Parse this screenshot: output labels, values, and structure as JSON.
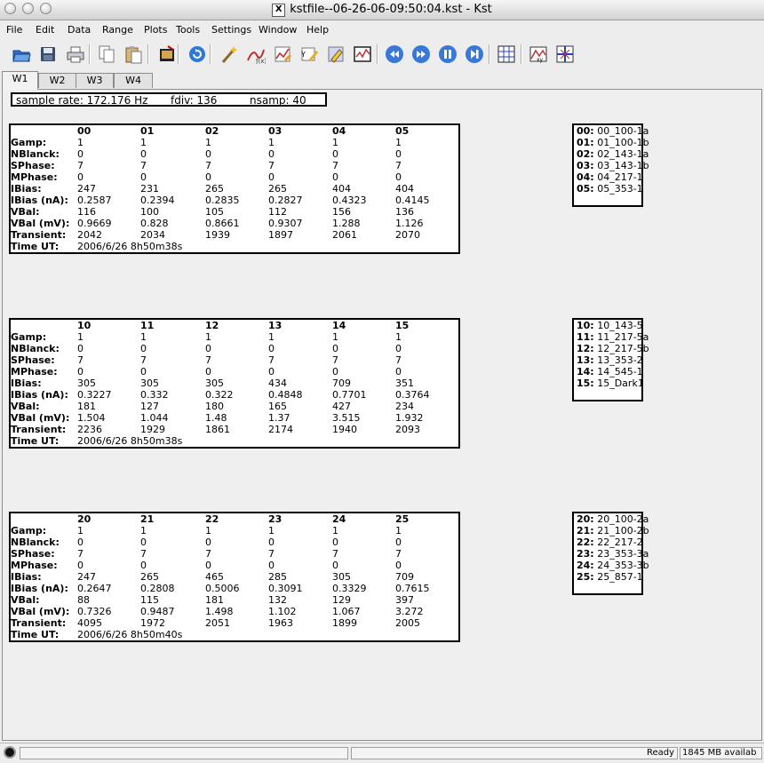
{
  "window": {
    "title": "kstfile--06-26-06-09:50:04.kst - Kst",
    "x_badge": "X"
  },
  "menu": [
    "File",
    "Edit",
    "Data",
    "Range",
    "Plots",
    "Tools",
    "Settings",
    "Window",
    "Help"
  ],
  "toolbar_icons": [
    "open-icon",
    "save-icon",
    "print-icon",
    "copy-icon",
    "paste-icon",
    "export-icon",
    "reload-icon",
    "data-wizard-icon",
    "plot-wizard-icon",
    "edit-plot-icon",
    "label-icon",
    "draw-icon",
    "graph-icon",
    "back-icon",
    "forward-icon",
    "pause-icon",
    "end-icon",
    "grid-icon",
    "plot-dialog-icon",
    "zoom-icon"
  ],
  "tabs": [
    "W1",
    "W2",
    "W3",
    "W4"
  ],
  "info": {
    "sample_rate": "sample rate: 172.176 Hz",
    "fdiv": "fdiv: 136",
    "nsamp": "nsamp: 40"
  },
  "row_labels": [
    "Gamp:",
    "NBlanck:",
    "SPhase:",
    "MPhase:",
    "IBias:",
    "IBias (nA):",
    "VBal:",
    "VBal (mV):",
    "Transient:",
    "Time UT:"
  ],
  "panels": [
    {
      "channels": [
        "00",
        "01",
        "02",
        "03",
        "04",
        "05"
      ],
      "rows": [
        [
          "1",
          "1",
          "1",
          "1",
          "1",
          "1"
        ],
        [
          "0",
          "0",
          "0",
          "0",
          "0",
          "0"
        ],
        [
          "7",
          "7",
          "7",
          "7",
          "7",
          "7"
        ],
        [
          "0",
          "0",
          "0",
          "0",
          "0",
          "0"
        ],
        [
          "247",
          "231",
          "265",
          "265",
          "404",
          "404"
        ],
        [
          "0.2587",
          "0.2394",
          "0.2835",
          "0.2827",
          "0.4323",
          "0.4145"
        ],
        [
          "116",
          "100",
          "105",
          "112",
          "156",
          "136"
        ],
        [
          "0.9669",
          "0.828",
          "0.8661",
          "0.9307",
          "1.288",
          "1.126"
        ],
        [
          "2042",
          "2034",
          "1939",
          "1897",
          "2061",
          "2070"
        ]
      ],
      "time": "2006/6/26 8h50m38s",
      "legend": [
        {
          "key": "00:",
          "val": "00_100-1a"
        },
        {
          "key": "01:",
          "val": "01_100-1b"
        },
        {
          "key": "02:",
          "val": "02_143-1a"
        },
        {
          "key": "03:",
          "val": "03_143-1b"
        },
        {
          "key": "04:",
          "val": "04_217-1"
        },
        {
          "key": "05:",
          "val": "05_353-1"
        }
      ]
    },
    {
      "channels": [
        "10",
        "11",
        "12",
        "13",
        "14",
        "15"
      ],
      "rows": [
        [
          "1",
          "1",
          "1",
          "1",
          "1",
          "1"
        ],
        [
          "0",
          "0",
          "0",
          "0",
          "0",
          "0"
        ],
        [
          "7",
          "7",
          "7",
          "7",
          "7",
          "7"
        ],
        [
          "0",
          "0",
          "0",
          "0",
          "0",
          "0"
        ],
        [
          "305",
          "305",
          "305",
          "434",
          "709",
          "351"
        ],
        [
          "0.3227",
          "0.332",
          "0.322",
          "0.4848",
          "0.7701",
          "0.3764"
        ],
        [
          "181",
          "127",
          "180",
          "165",
          "427",
          "234"
        ],
        [
          "1.504",
          "1.044",
          "1.48",
          "1.37",
          "3.515",
          "1.932"
        ],
        [
          "2236",
          "1929",
          "1861",
          "2174",
          "1940",
          "2093"
        ]
      ],
      "time": "2006/6/26 8h50m38s",
      "legend": [
        {
          "key": "10:",
          "val": "10_143-5"
        },
        {
          "key": "11:",
          "val": "11_217-5a"
        },
        {
          "key": "12:",
          "val": "12_217-5b"
        },
        {
          "key": "13:",
          "val": "13_353-2"
        },
        {
          "key": "14:",
          "val": "14_545-1"
        },
        {
          "key": "15:",
          "val": "15_Dark1"
        }
      ]
    },
    {
      "channels": [
        "20",
        "21",
        "22",
        "23",
        "24",
        "25"
      ],
      "rows": [
        [
          "1",
          "1",
          "1",
          "1",
          "1",
          "1"
        ],
        [
          "0",
          "0",
          "0",
          "0",
          "0",
          "0"
        ],
        [
          "7",
          "7",
          "7",
          "7",
          "7",
          "7"
        ],
        [
          "0",
          "0",
          "0",
          "0",
          "0",
          "0"
        ],
        [
          "247",
          "265",
          "465",
          "285",
          "305",
          "709"
        ],
        [
          "0.2647",
          "0.2808",
          "0.5006",
          "0.3091",
          "0.3329",
          "0.7615"
        ],
        [
          "88",
          "115",
          "181",
          "132",
          "129",
          "397"
        ],
        [
          "0.7326",
          "0.9487",
          "1.498",
          "1.102",
          "1.067",
          "3.272"
        ],
        [
          "4095",
          "1972",
          "2051",
          "1963",
          "1899",
          "2005"
        ]
      ],
      "time": "2006/6/26 8h50m40s",
      "legend": [
        {
          "key": "20:",
          "val": "20_100-2a"
        },
        {
          "key": "21:",
          "val": "21_100-2b"
        },
        {
          "key": "22:",
          "val": "22_217-2"
        },
        {
          "key": "23:",
          "val": "23_353-3a"
        },
        {
          "key": "24:",
          "val": "24_353-3b"
        },
        {
          "key": "25:",
          "val": "25_857-1"
        }
      ]
    }
  ],
  "status": {
    "state": "Ready",
    "memory": "1845 MB availab"
  }
}
